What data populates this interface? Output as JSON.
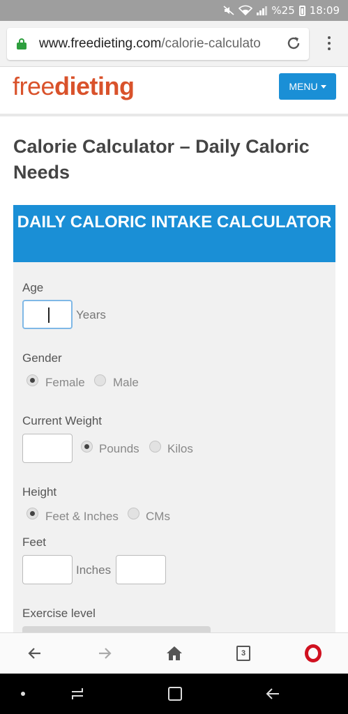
{
  "status_bar": {
    "percent": "%25",
    "time": "18:09",
    "icons": [
      "mute-icon",
      "wifi-icon",
      "signal-icon",
      "battery-icon"
    ]
  },
  "browser": {
    "url_host": "www.freedieting.com",
    "url_path": "/calorie-calculato",
    "icons": [
      "lock-icon",
      "reload-icon",
      "more-menu-icon"
    ],
    "tab_count": "3"
  },
  "site": {
    "logo_free": "free",
    "logo_dieting": "dieting",
    "menu_label": "MENU",
    "logo_color": "#d9522b",
    "accent": "#1a8fd6"
  },
  "page": {
    "title": "Calorie Calculator – Daily Caloric Needs"
  },
  "calculator": {
    "header": "DAILY CALORIC INTAKE CALCULATOR",
    "age": {
      "label": "Age",
      "value": "",
      "unit": "Years"
    },
    "gender": {
      "label": "Gender",
      "options": [
        "Female",
        "Male"
      ],
      "selected": "Female"
    },
    "weight": {
      "label": "Current Weight",
      "value": "",
      "options": [
        "Pounds",
        "Kilos"
      ],
      "selected": "Pounds"
    },
    "height": {
      "label": "Height",
      "options": [
        "Feet & Inches",
        "CMs"
      ],
      "selected": "Feet & Inches"
    },
    "feet": {
      "label": "Feet",
      "value": "",
      "inches_label": "Inches",
      "inches_value": ""
    },
    "exercise": {
      "label": "Exercise level"
    }
  },
  "bottom_toolbar": {
    "icons": [
      "back-arrow-icon",
      "forward-arrow-icon",
      "home-icon",
      "tabs-icon",
      "opera-icon"
    ]
  },
  "nav_bar": {
    "icons": [
      "dot-icon",
      "recent-apps-icon",
      "home-square-icon",
      "back-icon"
    ]
  }
}
